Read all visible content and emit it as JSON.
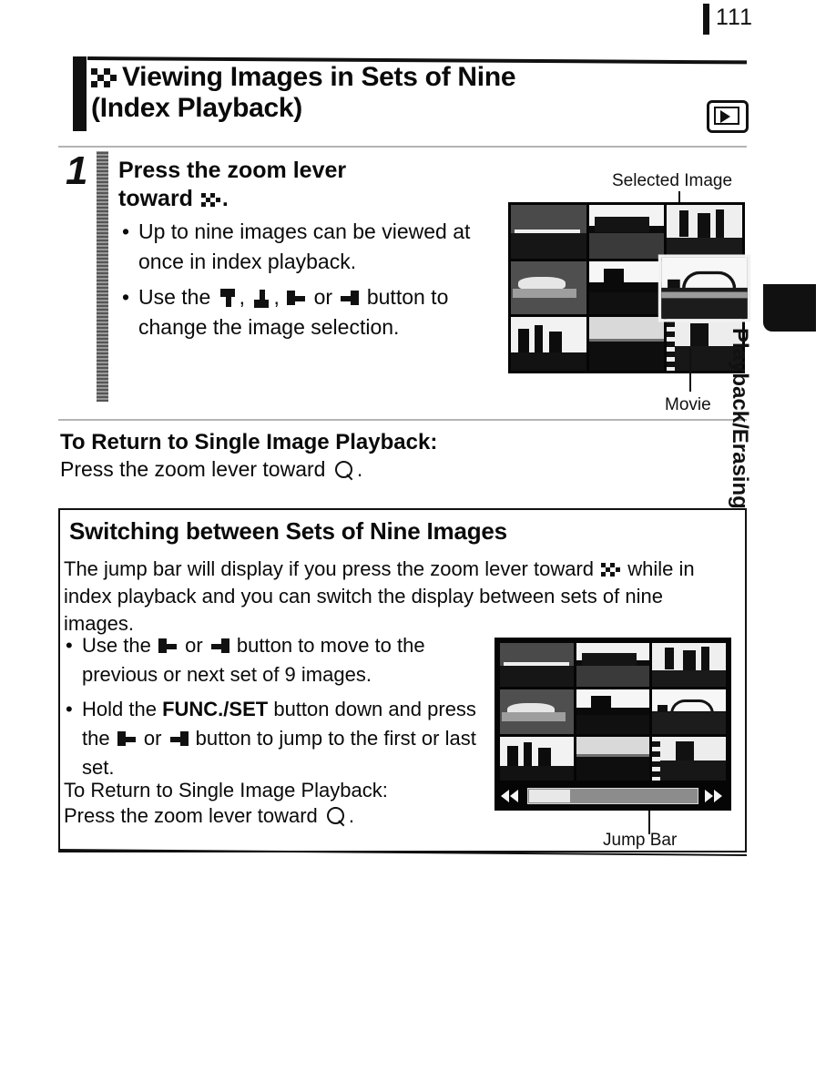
{
  "page": {
    "number": "111",
    "side_tab_label": "Playback/Erasing"
  },
  "header": {
    "icon": "index-checkerboard-icon",
    "title_line1": "Viewing Images in Sets of Nine",
    "title_line2": "(Index Playback)",
    "mode_icon": "playback-mode-icon"
  },
  "step": {
    "number": "1",
    "heading_line1": "Press the zoom lever",
    "heading_line2_prefix": "toward",
    "heading_line2_suffix": ".",
    "bullets": [
      {
        "text": "Up to nine images can be viewed at once in index playback."
      },
      {
        "prefix": "Use the",
        "mid1": ",",
        "mid2": ",",
        "mid3": "or",
        "suffix": "button to change the image selection."
      }
    ]
  },
  "return_block_1": {
    "heading": "To Return to Single Image Playback:",
    "body_prefix": "Press the zoom lever toward",
    "body_suffix": "."
  },
  "screen_1": {
    "callout_top": "Selected Image",
    "callout_bottom": "Movie"
  },
  "box": {
    "title": "Switching between Sets of Nine Images",
    "intro_part1": "The jump bar will display if you press the zoom lever toward",
    "intro_part2": "while in index playback and you can switch the display between sets of nine images.",
    "bullets": [
      {
        "prefix": "Use the",
        "mid": "or",
        "suffix": "button to move to the previous or next set of 9 images."
      },
      {
        "prefix": "Hold the",
        "bold": "FUNC./SET",
        "mid_a": "button down and press the",
        "mid_b": "or",
        "suffix": "button to jump to the first or last set."
      }
    ],
    "return_heading": "To Return to Single Image Playback:",
    "return_body_prefix": "Press the zoom lever toward",
    "return_body_suffix": "."
  },
  "screen_2": {
    "callout_bottom": "Jump Bar",
    "jump_bar_left_icon": "rewind-double-arrow-icon",
    "jump_bar_right_icon": "forward-double-arrow-icon"
  },
  "colors": {
    "ink": "#111111",
    "paper": "#ffffff",
    "rule": "#b4b4b4"
  }
}
